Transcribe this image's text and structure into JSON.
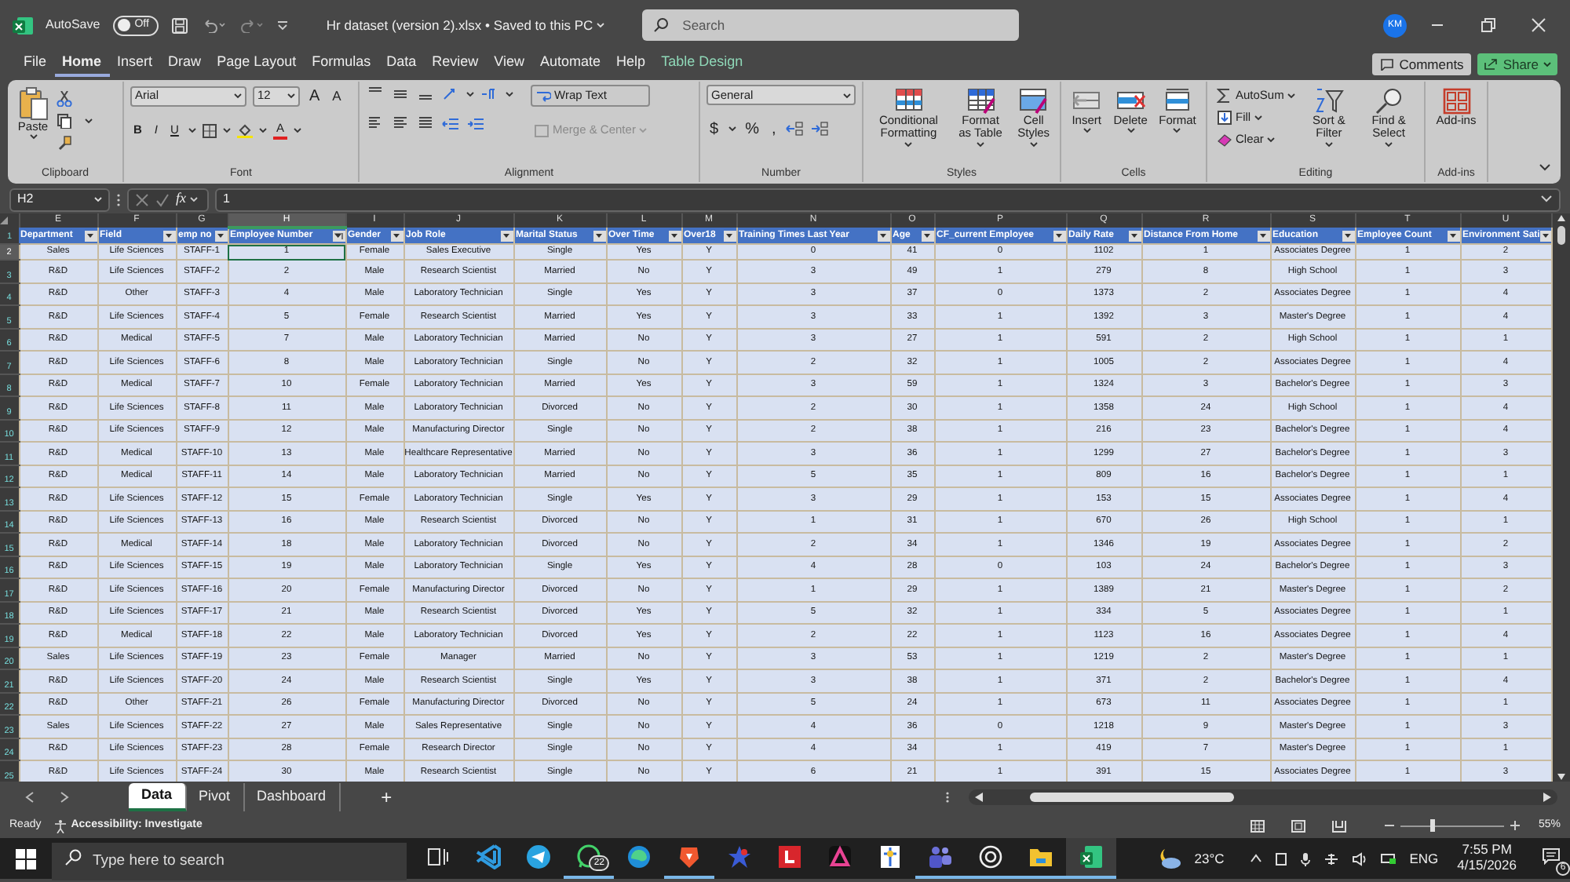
{
  "title_bar": {
    "autosave_label": "AutoSave",
    "autosave_on": false,
    "autosave_state": "Off",
    "file_title": "Hr dataset (version 2).xlsx • Saved to this PC",
    "search_placeholder": "Search",
    "avatar": "KM"
  },
  "menu_tabs": [
    {
      "label": "File",
      "kind": "standard",
      "selected": false
    },
    {
      "label": "Home",
      "kind": "standard",
      "selected": true
    },
    {
      "label": "Insert",
      "kind": "standard",
      "selected": false
    },
    {
      "label": "Draw",
      "kind": "standard",
      "selected": false
    },
    {
      "label": "Page Layout",
      "kind": "standard",
      "selected": false
    },
    {
      "label": "Formulas",
      "kind": "standard",
      "selected": false
    },
    {
      "label": "Data",
      "kind": "standard",
      "selected": false
    },
    {
      "label": "Review",
      "kind": "standard",
      "selected": false
    },
    {
      "label": "View",
      "kind": "standard",
      "selected": false
    },
    {
      "label": "Automate",
      "kind": "standard",
      "selected": false
    },
    {
      "label": "Help",
      "kind": "standard",
      "selected": false
    },
    {
      "label": "Table Design",
      "kind": "contextual",
      "selected": false
    }
  ],
  "comments_button": "Comments",
  "share_button": "Share",
  "ribbon": [
    {
      "kind": "clipboard",
      "name": "Clipboard",
      "paste": "Paste"
    },
    {
      "kind": "font",
      "name": "Font",
      "font_name": "Arial",
      "font_size": "12",
      "size_buttons": [
        "A",
        "A"
      ],
      "styles": [
        "B",
        "I",
        "U"
      ],
      "font_color": "A"
    },
    {
      "kind": "alignment",
      "name": "Alignment",
      "wrap": "Wrap Text",
      "merge": {
        "label": "Merge & Center",
        "disabled": true
      }
    },
    {
      "kind": "number",
      "name": "Number",
      "format": "General",
      "symbols": [
        "$",
        "%",
        ","
      ]
    },
    {
      "kind": "styles",
      "name": "Styles",
      "buttons": [
        "Conditional Formatting",
        "Format as Table",
        "Cell Styles"
      ]
    },
    {
      "kind": "cells",
      "name": "Cells",
      "buttons": [
        "Insert",
        "Delete",
        "Format"
      ]
    },
    {
      "kind": "editing",
      "name": "Editing",
      "small": [
        "AutoSum",
        "Fill",
        "Clear"
      ],
      "large": [
        "Sort & Filter",
        "Find & Select"
      ]
    },
    {
      "kind": "addins",
      "name": "Add-ins",
      "buttons": [
        "Add-ins"
      ]
    }
  ],
  "formula_bar": {
    "name_box": "H2",
    "fx": "fx",
    "value": "1"
  },
  "sheet": {
    "header_row_number": "1",
    "columns": [
      {
        "letter": "E",
        "header": "Department",
        "selected": false
      },
      {
        "letter": "F",
        "header": "Field",
        "selected": false
      },
      {
        "letter": "G",
        "header": "emp no",
        "selected": false
      },
      {
        "letter": "H",
        "header": "Employee Number",
        "selected": true
      },
      {
        "letter": "I",
        "header": "Gender",
        "selected": false
      },
      {
        "letter": "J",
        "header": "Job Role",
        "selected": false
      },
      {
        "letter": "K",
        "header": "Marital Status",
        "selected": false
      },
      {
        "letter": "L",
        "header": "Over Time",
        "selected": false
      },
      {
        "letter": "M",
        "header": "Over18",
        "selected": false
      },
      {
        "letter": "N",
        "header": "Training Times Last Year",
        "selected": false
      },
      {
        "letter": "O",
        "header": "Age",
        "selected": false
      },
      {
        "letter": "P",
        "header": "CF_current Employee",
        "selected": false
      },
      {
        "letter": "Q",
        "header": "Daily Rate",
        "selected": false
      },
      {
        "letter": "R",
        "header": "Distance From Home",
        "selected": false
      },
      {
        "letter": "S",
        "header": "Education",
        "selected": false
      },
      {
        "letter": "T",
        "header": "Employee Count",
        "selected": false
      },
      {
        "letter": "U",
        "header": "Environment Sati",
        "selected": false
      }
    ],
    "rows": [
      {
        "number": "2",
        "selected": true,
        "cells": [
          "Sales",
          "Life Sciences",
          "STAFF-1",
          "1",
          "Female",
          "Sales Executive",
          "Single",
          "Yes",
          "Y",
          "0",
          "41",
          "0",
          "1102",
          "1",
          "Associates Degree",
          "1",
          "2"
        ]
      },
      {
        "number": "3",
        "selected": false,
        "cells": [
          "R&D",
          "Life Sciences",
          "STAFF-2",
          "2",
          "Male",
          "Research Scientist",
          "Married",
          "No",
          "Y",
          "3",
          "49",
          "1",
          "279",
          "8",
          "High School",
          "1",
          "3"
        ]
      },
      {
        "number": "4",
        "selected": false,
        "cells": [
          "R&D",
          "Other",
          "STAFF-3",
          "4",
          "Male",
          "Laboratory Technician",
          "Single",
          "Yes",
          "Y",
          "3",
          "37",
          "0",
          "1373",
          "2",
          "Associates Degree",
          "1",
          "4"
        ]
      },
      {
        "number": "5",
        "selected": false,
        "cells": [
          "R&D",
          "Life Sciences",
          "STAFF-4",
          "5",
          "Female",
          "Research Scientist",
          "Married",
          "Yes",
          "Y",
          "3",
          "33",
          "1",
          "1392",
          "3",
          "Master's Degree",
          "1",
          "4"
        ]
      },
      {
        "number": "6",
        "selected": false,
        "cells": [
          "R&D",
          "Medical",
          "STAFF-5",
          "7",
          "Male",
          "Laboratory Technician",
          "Married",
          "No",
          "Y",
          "3",
          "27",
          "1",
          "591",
          "2",
          "High School",
          "1",
          "1"
        ]
      },
      {
        "number": "7",
        "selected": false,
        "cells": [
          "R&D",
          "Life Sciences",
          "STAFF-6",
          "8",
          "Male",
          "Laboratory Technician",
          "Single",
          "No",
          "Y",
          "2",
          "32",
          "1",
          "1005",
          "2",
          "Associates Degree",
          "1",
          "4"
        ]
      },
      {
        "number": "8",
        "selected": false,
        "cells": [
          "R&D",
          "Medical",
          "STAFF-7",
          "10",
          "Female",
          "Laboratory Technician",
          "Married",
          "Yes",
          "Y",
          "3",
          "59",
          "1",
          "1324",
          "3",
          "Bachelor's Degree",
          "1",
          "3"
        ]
      },
      {
        "number": "9",
        "selected": false,
        "cells": [
          "R&D",
          "Life Sciences",
          "STAFF-8",
          "11",
          "Male",
          "Laboratory Technician",
          "Divorced",
          "No",
          "Y",
          "2",
          "30",
          "1",
          "1358",
          "24",
          "High School",
          "1",
          "4"
        ]
      },
      {
        "number": "10",
        "selected": false,
        "cells": [
          "R&D",
          "Life Sciences",
          "STAFF-9",
          "12",
          "Male",
          "Manufacturing Director",
          "Single",
          "No",
          "Y",
          "2",
          "38",
          "1",
          "216",
          "23",
          "Bachelor's Degree",
          "1",
          "4"
        ]
      },
      {
        "number": "11",
        "selected": false,
        "cells": [
          "R&D",
          "Medical",
          "STAFF-10",
          "13",
          "Male",
          "Healthcare Representative",
          "Married",
          "No",
          "Y",
          "3",
          "36",
          "1",
          "1299",
          "27",
          "Bachelor's Degree",
          "1",
          "3"
        ]
      },
      {
        "number": "12",
        "selected": false,
        "cells": [
          "R&D",
          "Medical",
          "STAFF-11",
          "14",
          "Male",
          "Laboratory Technician",
          "Married",
          "No",
          "Y",
          "5",
          "35",
          "1",
          "809",
          "16",
          "Bachelor's Degree",
          "1",
          "1"
        ]
      },
      {
        "number": "13",
        "selected": false,
        "cells": [
          "R&D",
          "Life Sciences",
          "STAFF-12",
          "15",
          "Female",
          "Laboratory Technician",
          "Single",
          "Yes",
          "Y",
          "3",
          "29",
          "1",
          "153",
          "15",
          "Associates Degree",
          "1",
          "4"
        ]
      },
      {
        "number": "14",
        "selected": false,
        "cells": [
          "R&D",
          "Life Sciences",
          "STAFF-13",
          "16",
          "Male",
          "Research Scientist",
          "Divorced",
          "No",
          "Y",
          "1",
          "31",
          "1",
          "670",
          "26",
          "High School",
          "1",
          "1"
        ]
      },
      {
        "number": "15",
        "selected": false,
        "cells": [
          "R&D",
          "Medical",
          "STAFF-14",
          "18",
          "Male",
          "Laboratory Technician",
          "Divorced",
          "No",
          "Y",
          "2",
          "34",
          "1",
          "1346",
          "19",
          "Associates Degree",
          "1",
          "2"
        ]
      },
      {
        "number": "16",
        "selected": false,
        "cells": [
          "R&D",
          "Life Sciences",
          "STAFF-15",
          "19",
          "Male",
          "Laboratory Technician",
          "Single",
          "Yes",
          "Y",
          "4",
          "28",
          "0",
          "103",
          "24",
          "Bachelor's Degree",
          "1",
          "3"
        ]
      },
      {
        "number": "17",
        "selected": false,
        "cells": [
          "R&D",
          "Life Sciences",
          "STAFF-16",
          "20",
          "Female",
          "Manufacturing Director",
          "Divorced",
          "No",
          "Y",
          "1",
          "29",
          "1",
          "1389",
          "21",
          "Master's Degree",
          "1",
          "2"
        ]
      },
      {
        "number": "18",
        "selected": false,
        "cells": [
          "R&D",
          "Life Sciences",
          "STAFF-17",
          "21",
          "Male",
          "Research Scientist",
          "Divorced",
          "Yes",
          "Y",
          "5",
          "32",
          "1",
          "334",
          "5",
          "Associates Degree",
          "1",
          "1"
        ]
      },
      {
        "number": "19",
        "selected": false,
        "cells": [
          "R&D",
          "Medical",
          "STAFF-18",
          "22",
          "Male",
          "Laboratory Technician",
          "Divorced",
          "Yes",
          "Y",
          "2",
          "22",
          "1",
          "1123",
          "16",
          "Associates Degree",
          "1",
          "4"
        ]
      },
      {
        "number": "20",
        "selected": false,
        "cells": [
          "Sales",
          "Life Sciences",
          "STAFF-19",
          "23",
          "Female",
          "Manager",
          "Married",
          "No",
          "Y",
          "3",
          "53",
          "1",
          "1219",
          "2",
          "Master's Degree",
          "1",
          "1"
        ]
      },
      {
        "number": "21",
        "selected": false,
        "cells": [
          "R&D",
          "Life Sciences",
          "STAFF-20",
          "24",
          "Male",
          "Research Scientist",
          "Single",
          "Yes",
          "Y",
          "3",
          "38",
          "1",
          "371",
          "2",
          "Bachelor's Degree",
          "1",
          "4"
        ]
      },
      {
        "number": "22",
        "selected": false,
        "cells": [
          "R&D",
          "Other",
          "STAFF-21",
          "26",
          "Female",
          "Manufacturing Director",
          "Divorced",
          "No",
          "Y",
          "5",
          "24",
          "1",
          "673",
          "11",
          "Associates Degree",
          "1",
          "1"
        ]
      },
      {
        "number": "23",
        "selected": false,
        "cells": [
          "Sales",
          "Life Sciences",
          "STAFF-22",
          "27",
          "Male",
          "Sales Representative",
          "Single",
          "No",
          "Y",
          "4",
          "36",
          "0",
          "1218",
          "9",
          "Master's Degree",
          "1",
          "3"
        ]
      },
      {
        "number": "24",
        "selected": false,
        "cells": [
          "R&D",
          "Life Sciences",
          "STAFF-23",
          "28",
          "Female",
          "Research Director",
          "Single",
          "No",
          "Y",
          "4",
          "34",
          "1",
          "419",
          "7",
          "Master's Degree",
          "1",
          "1"
        ]
      },
      {
        "number": "25",
        "selected": false,
        "cells": [
          "R&D",
          "Life Sciences",
          "STAFF-24",
          "30",
          "Male",
          "Research Scientist",
          "Single",
          "No",
          "Y",
          "6",
          "21",
          "1",
          "391",
          "15",
          "Associates Degree",
          "1",
          "3"
        ]
      }
    ]
  },
  "sheet_tabs": [
    {
      "label": "Data",
      "selected": true
    },
    {
      "label": "Pivot",
      "selected": false
    },
    {
      "label": "Dashboard",
      "selected": false
    }
  ],
  "add_sheet": "+",
  "status_bar": {
    "ready": "Ready",
    "accessibility": "Accessibility: Investigate",
    "zoom_slider": {
      "level": 0.3
    },
    "zoom": "55%"
  },
  "taskbar": {
    "search_placeholder": "Type here to search",
    "apps": [
      {
        "kind": "taskview",
        "running": false,
        "selected": false
      },
      {
        "kind": "code",
        "running": false,
        "selected": false
      },
      {
        "kind": "plane",
        "running": false,
        "selected": false
      },
      {
        "kind": "chat",
        "running": true,
        "selected": false,
        "badge": "22"
      },
      {
        "kind": "browser",
        "running": false,
        "selected": false
      },
      {
        "kind": "shield",
        "running": true,
        "selected": false
      },
      {
        "kind": "star",
        "running": false,
        "selected": false
      },
      {
        "kind": "redtile",
        "running": false,
        "selected": false
      },
      {
        "kind": "triangle",
        "running": false,
        "selected": false
      },
      {
        "kind": "doc",
        "running": false,
        "selected": false
      },
      {
        "kind": "people",
        "running": true,
        "selected": false
      },
      {
        "kind": "knot",
        "running": true,
        "selected": false
      },
      {
        "kind": "folder",
        "running": true,
        "selected": false
      },
      {
        "kind": "sheet",
        "running": true,
        "selected": true
      }
    ],
    "weather": "23°C",
    "language": "ENG",
    "time": "7:55 PM",
    "date": "4/15/2026",
    "notifications": "6"
  }
}
